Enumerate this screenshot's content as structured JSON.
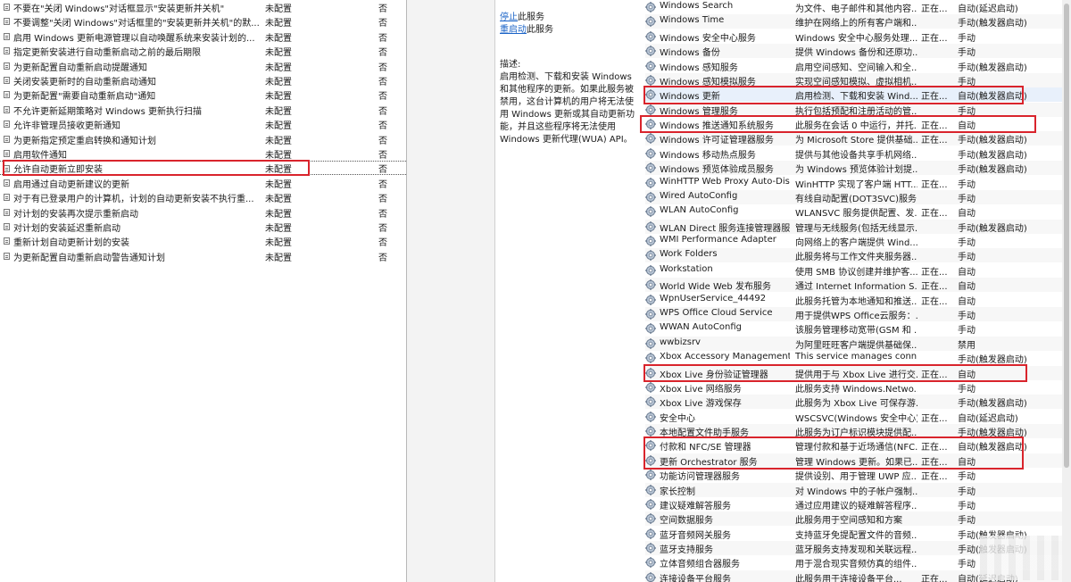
{
  "policy_list": {
    "rows": [
      {
        "name": "不要在\"关闭 Windows\"对话框显示\"安装更新并关机\"",
        "state": "未配置",
        "comment": "否"
      },
      {
        "name": "不要调整\"关闭 Windows\"对话框里的\"安装更新并关机\"的默...",
        "state": "未配置",
        "comment": "否"
      },
      {
        "name": "启用 Windows 更新电源管理以自动唤醒系统来安装计划的...",
        "state": "未配置",
        "comment": "否"
      },
      {
        "name": "指定更新安装进行自动重新启动之前的最后期限",
        "state": "未配置",
        "comment": "否"
      },
      {
        "name": "为更新配置自动重新启动提醒通知",
        "state": "未配置",
        "comment": "否"
      },
      {
        "name": "关闭安装更新时的自动重新启动通知",
        "state": "未配置",
        "comment": "否"
      },
      {
        "name": "为更新配置\"需要自动重新启动\"通知",
        "state": "未配置",
        "comment": "否"
      },
      {
        "name": "不允许更新延期策略对 Windows 更新执行扫描",
        "state": "未配置",
        "comment": "否"
      },
      {
        "name": "允许非管理员接收更新通知",
        "state": "未配置",
        "comment": "否"
      },
      {
        "name": "为更新指定预定重启转换和通知计划",
        "state": "未配置",
        "comment": "否"
      },
      {
        "name": "启用软件通知",
        "state": "未配置",
        "comment": "否"
      },
      {
        "name": "允许自动更新立即安装",
        "state": "未配置",
        "comment": "否"
      },
      {
        "name": "启用通过自动更新建议的更新",
        "state": "未配置",
        "comment": "否"
      },
      {
        "name": "对于有已登录用户的计算机，计划的自动更新安装不执行重...",
        "state": "未配置",
        "comment": "否"
      },
      {
        "name": "对计划的安装再次提示重新启动",
        "state": "未配置",
        "comment": "否"
      },
      {
        "name": "对计划的安装延迟重新启动",
        "state": "未配置",
        "comment": "否"
      },
      {
        "name": "重新计划自动更新计划的安装",
        "state": "未配置",
        "comment": "否"
      },
      {
        "name": "为更新配置自动重新启动警告通知计划",
        "state": "未配置",
        "comment": "否"
      }
    ]
  },
  "service_panel": {
    "stop_link": "停止",
    "stop_suffix": "此服务",
    "restart_link": "重启动",
    "restart_suffix": "此服务",
    "description_label": "描述:",
    "description_text": "启用检测、下载和安装 Windows 和其他程序的更新。如果此服务被禁用，这台计算机的用户将无法使用 Windows 更新或其自动更新功能，并且这些程序将无法使用 Windows 更新代理(WUA) API。"
  },
  "services": {
    "rows": [
      {
        "name": "Windows Search",
        "desc": "为文件、电子邮件和其他内容...",
        "status": "正在...",
        "startup": "自动(延迟启动)"
      },
      {
        "name": "Windows Time",
        "desc": "维护在网络上的所有客户端和...",
        "status": "",
        "startup": "手动(触发器启动)"
      },
      {
        "name": "Windows 安全中心服务",
        "desc": "Windows 安全中心服务处理...",
        "status": "正在...",
        "startup": "手动"
      },
      {
        "name": "Windows 备份",
        "desc": "提供 Windows 备份和还原功...",
        "status": "",
        "startup": "手动"
      },
      {
        "name": "Windows 感知服务",
        "desc": "启用空间感知、空间输入和全...",
        "status": "",
        "startup": "手动(触发器启动)"
      },
      {
        "name": "Windows 感知模拟服务",
        "desc": "实现空间感知模拟、虚拟相机...",
        "status": "",
        "startup": "手动"
      },
      {
        "name": "Windows 更新",
        "desc": "启用检测、下载和安装 Wind...",
        "status": "正在...",
        "startup": "自动(触发器启动)"
      },
      {
        "name": "Windows 管理服务",
        "desc": "执行包括预配和注册活动的管...",
        "status": "",
        "startup": "手动"
      },
      {
        "name": "Windows 推送通知系统服务",
        "desc": "此服务在会话 0 中运行，并托...",
        "status": "正在...",
        "startup": "自动"
      },
      {
        "name": "Windows 许可证管理器服务",
        "desc": "为 Microsoft Store 提供基础...",
        "status": "正在...",
        "startup": "手动(触发器启动)"
      },
      {
        "name": "Windows 移动热点服务",
        "desc": "提供与其他设备共享手机网络...",
        "status": "",
        "startup": "手动(触发器启动)"
      },
      {
        "name": "Windows 预览体验成员服务",
        "desc": "为 Windows 预览体验计划提...",
        "status": "",
        "startup": "手动(触发器启动)"
      },
      {
        "name": "WinHTTP Web Proxy Auto-Dis...",
        "desc": "WinHTTP 实现了客户端 HTT...",
        "status": "正在...",
        "startup": "手动"
      },
      {
        "name": "Wired AutoConfig",
        "desc": "有线自动配置(DOT3SVC)服务...",
        "status": "",
        "startup": "手动"
      },
      {
        "name": "WLAN AutoConfig",
        "desc": "WLANSVC 服务提供配置、发...",
        "status": "正在...",
        "startup": "自动"
      },
      {
        "name": "WLAN Direct 服务连接管理器服务",
        "desc": "管理与无线服务(包括无线显示...",
        "status": "",
        "startup": "手动(触发器启动)"
      },
      {
        "name": "WMI Performance Adapter",
        "desc": "向网络上的客户端提供 Wind...",
        "status": "",
        "startup": "手动"
      },
      {
        "name": "Work Folders",
        "desc": "此服务将与工作文件夹服务器...",
        "status": "",
        "startup": "手动"
      },
      {
        "name": "Workstation",
        "desc": "使用 SMB 协议创建并维护客...",
        "status": "正在...",
        "startup": "自动"
      },
      {
        "name": "World Wide Web 发布服务",
        "desc": "通过 Internet Information S...",
        "status": "正在...",
        "startup": "自动"
      },
      {
        "name": "WpnUserService_44492",
        "desc": "此服务托管为本地通知和推送...",
        "status": "正在...",
        "startup": "自动"
      },
      {
        "name": "WPS Office Cloud Service",
        "desc": "用于提供WPS Office云服务：...",
        "status": "",
        "startup": "手动"
      },
      {
        "name": "WWAN AutoConfig",
        "desc": "该服务管理移动宽带(GSM 和 ...",
        "status": "",
        "startup": "手动"
      },
      {
        "name": "wwbizsrv",
        "desc": "为阿里旺旺客户端提供基础保...",
        "status": "",
        "startup": "禁用"
      },
      {
        "name": "Xbox Accessory Management ...",
        "desc": "This service manages conn...",
        "status": "",
        "startup": "手动(触发器启动)"
      },
      {
        "name": "Xbox Live 身份验证管理器",
        "desc": "提供用于与 Xbox Live 进行交...",
        "status": "正在...",
        "startup": "自动"
      },
      {
        "name": "Xbox Live 网络服务",
        "desc": "此服务支持 Windows.Netwo...",
        "status": "",
        "startup": "手动"
      },
      {
        "name": "Xbox Live 游戏保存",
        "desc": "此服务为 Xbox Live 可保存游...",
        "status": "",
        "startup": "手动(触发器启动)"
      },
      {
        "name": "安全中心",
        "desc": "WSCSVC(Windows 安全中心)...",
        "status": "正在...",
        "startup": "自动(延迟启动)"
      },
      {
        "name": "本地配置文件助手服务",
        "desc": "此服务为订户标识模块提供配...",
        "status": "",
        "startup": "手动(触发器启动)"
      },
      {
        "name": "付款和 NFC/SE 管理器",
        "desc": "管理付款和基于近场通信(NFC...",
        "status": "正在...",
        "startup": "自动(触发器启动)"
      },
      {
        "name": "更新 Orchestrator 服务",
        "desc": "管理 Windows 更新。如果已...",
        "status": "正在...",
        "startup": "自动"
      },
      {
        "name": "功能访问管理器服务",
        "desc": "提供设别、用于管理 UWP 应...",
        "status": "正在...",
        "startup": "手动"
      },
      {
        "name": "家长控制",
        "desc": "对 Windows 中的子帐户强制...",
        "status": "",
        "startup": "手动"
      },
      {
        "name": "建议疑难解答服务",
        "desc": "通过应用建议的疑难解答程序...",
        "status": "",
        "startup": "手动"
      },
      {
        "name": "空间数据服务",
        "desc": "此服务用于空间感知和方案",
        "status": "",
        "startup": "手动"
      },
      {
        "name": "蓝牙音频网关服务",
        "desc": "支持蓝牙免提配置文件的音频...",
        "status": "",
        "startup": "手动(触发器启动)"
      },
      {
        "name": "蓝牙支持服务",
        "desc": "蓝牙服务支持发现和关联远程...",
        "status": "",
        "startup": "手动(触发器启动)"
      },
      {
        "name": "立体音频组合器服务",
        "desc": "用于混合现实音频仿真的组件...",
        "status": "",
        "startup": "手动"
      },
      {
        "name": "连接设备平台服务",
        "desc": "此服务用于连接设备平台...",
        "status": "正在...",
        "startup": "自动(延迟启动)"
      }
    ]
  }
}
